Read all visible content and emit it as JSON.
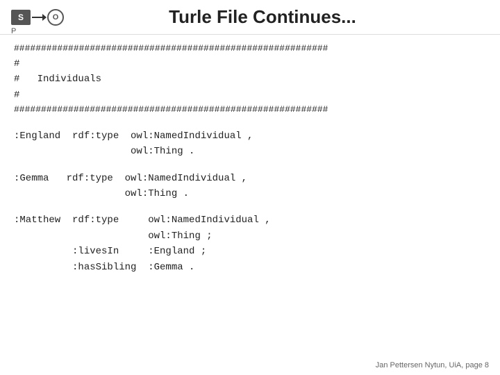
{
  "header": {
    "logo": {
      "s_label": "S",
      "o_label": "O",
      "p_label": "P"
    },
    "title": "Turle File Continues..."
  },
  "content": {
    "hash_line_1": "##########################################################",
    "comment_blank_1": "#",
    "comment_individuals": "#   Individuals",
    "comment_blank_2": "#",
    "hash_line_2": "##########################################################",
    "england_line1": ":England  rdf:type  owl:NamedIndividual ,",
    "england_line2": "                    owl:Thing .",
    "gemma_line1": ":Gemma   rdf:type  owl:NamedIndividual ,",
    "gemma_line2": "                   owl:Thing .",
    "matthew_line1": ":Matthew  rdf:type     owl:NamedIndividual ,",
    "matthew_line2": "                       owl:Thing ;",
    "matthew_line3": "          :livesIn     :England ;",
    "matthew_line4": "          :hasSibling  :Gemma ."
  },
  "footer": {
    "text": "Jan Pettersen Nytun, UiA, page 8"
  }
}
